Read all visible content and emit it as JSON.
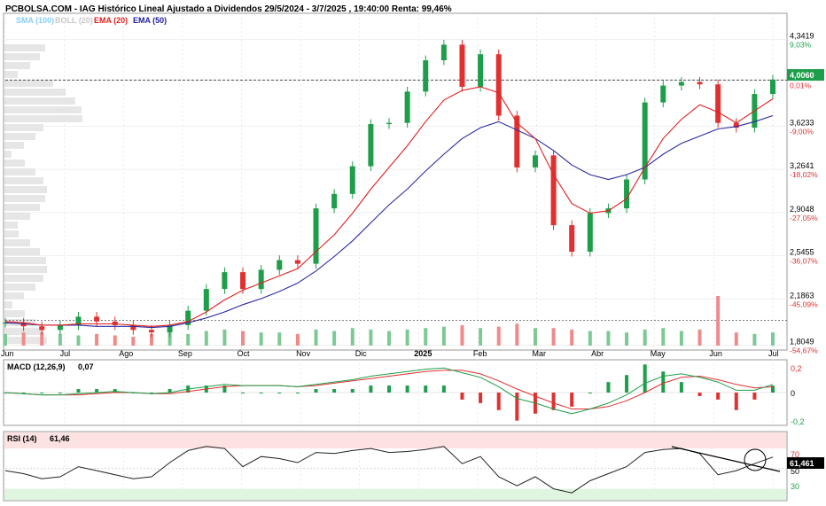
{
  "header": {
    "title": "PCBOLSA.COM - IAG Histórico Lineal Ajustado a Dividendos 29/5/2024 - 3/7/2025 , 19:40:00 Renta: 99,46%"
  },
  "legend": [
    {
      "label": "SMA (100)",
      "color": "#87cefa"
    },
    {
      "label": "BOLL (20)",
      "color": "#cccccc"
    },
    {
      "label": "EMA (20)",
      "color": "#e02020"
    },
    {
      "label": "EMA (50)",
      "color": "#2020a0"
    }
  ],
  "colors": {
    "up": "#1e9e4a",
    "down": "#e03030",
    "ema20": "#e02020",
    "ema50": "#2a2aa0",
    "current_price_tag": "#1e9e4a",
    "rsi_tag": "#000000"
  },
  "x_labels": [
    "Jun",
    "Jul",
    "Ago",
    "Sep",
    "Oct",
    "Nov",
    "Dic",
    "2025",
    "Feb",
    "Mar",
    "Abr",
    "May",
    "Jun",
    "Jul"
  ],
  "price_axis": [
    {
      "value": "4,3419",
      "pct": "9,03%"
    },
    {
      "value": "4,0060",
      "pct": "0,01%"
    },
    {
      "value": "3,6233",
      "pct": "-9,00%"
    },
    {
      "value": "3,2641",
      "pct": "-18,02%"
    },
    {
      "value": "2,9048",
      "pct": "-27,05%"
    },
    {
      "value": "2,5455",
      "pct": "-36,07%"
    },
    {
      "value": "2,1863",
      "pct": "-45,09%"
    },
    {
      "value": "1,8049",
      "pct": "-54,67%"
    }
  ],
  "current_price": "4,0060",
  "macd": {
    "label": "MACD (12,26,9)",
    "value": "0,07",
    "axis": [
      "0,2",
      "0",
      "-0,2"
    ]
  },
  "rsi": {
    "label": "RSI (14)",
    "value": "61,46",
    "current": "61,461",
    "axis": [
      "70",
      "50",
      "30"
    ]
  },
  "chart_data": {
    "type": "candlestick",
    "title": "PCBOLSA.COM - IAG Histórico Lineal Ajustado a Dividendos 29/5/2024 - 3/7/2025 , 19:40:00 Renta: 99,46%",
    "ylim": [
      1.8,
      4.45
    ],
    "x": [
      "Jun",
      "Jul",
      "Ago",
      "Sep",
      "Oct",
      "Nov",
      "Dic",
      "2025",
      "Feb",
      "Mar",
      "Abr",
      "May",
      "Jun",
      "Jul"
    ],
    "series": [
      {
        "name": "price",
        "values": [
          1.99,
          1.96,
          1.93,
          1.97,
          2.04,
          2.0,
          1.97,
          1.93,
          1.91,
          1.97,
          2.09,
          2.27,
          2.41,
          2.27,
          2.43,
          2.51,
          2.48,
          2.94,
          3.06,
          3.29,
          3.64,
          3.65,
          3.91,
          4.17,
          4.3,
          3.95,
          4.22,
          3.71,
          3.28,
          3.38,
          2.8,
          2.58,
          2.9,
          2.94,
          3.18,
          3.82,
          3.96,
          3.99,
          3.97,
          3.65,
          3.61,
          3.89,
          4.01
        ]
      },
      {
        "name": "EMA (20)",
        "values": [
          2.0,
          1.99,
          1.97,
          1.97,
          1.98,
          1.98,
          1.98,
          1.97,
          1.96,
          1.97,
          2.0,
          2.08,
          2.18,
          2.26,
          2.32,
          2.38,
          2.44,
          2.58,
          2.72,
          2.9,
          3.1,
          3.28,
          3.46,
          3.66,
          3.84,
          3.92,
          3.95,
          3.9,
          3.65,
          3.52,
          3.22,
          2.98,
          2.9,
          2.92,
          3.02,
          3.28,
          3.52,
          3.68,
          3.8,
          3.74,
          3.65,
          3.75,
          3.85
        ]
      },
      {
        "name": "EMA (50)",
        "values": [
          1.99,
          1.98,
          1.97,
          1.97,
          1.97,
          1.96,
          1.96,
          1.96,
          1.95,
          1.96,
          1.99,
          2.03,
          2.08,
          2.14,
          2.19,
          2.25,
          2.32,
          2.42,
          2.54,
          2.67,
          2.82,
          2.97,
          3.1,
          3.25,
          3.39,
          3.52,
          3.61,
          3.66,
          3.59,
          3.52,
          3.42,
          3.3,
          3.22,
          3.18,
          3.22,
          3.28,
          3.39,
          3.48,
          3.54,
          3.6,
          3.62,
          3.66,
          3.71
        ]
      }
    ],
    "volume": [
      8,
      9,
      9,
      8,
      7,
      8,
      7,
      6,
      8,
      9,
      8,
      10,
      11,
      10,
      9,
      9,
      8,
      11,
      10,
      12,
      11,
      10,
      11,
      12,
      13,
      14,
      12,
      13,
      15,
      12,
      12,
      11,
      10,
      10,
      9,
      11,
      12,
      10,
      11,
      34,
      9,
      8,
      9
    ],
    "macd": {
      "ylim": [
        -0.25,
        0.25
      ],
      "macd": [
        0.0,
        -0.01,
        -0.02,
        -0.02,
        -0.01,
        0.0,
        0.01,
        0.0,
        -0.01,
        0.0,
        0.03,
        0.05,
        0.07,
        0.06,
        0.06,
        0.06,
        0.05,
        0.07,
        0.09,
        0.11,
        0.14,
        0.16,
        0.18,
        0.2,
        0.21,
        0.17,
        0.13,
        0.05,
        -0.05,
        -0.09,
        -0.14,
        -0.18,
        -0.14,
        -0.09,
        -0.02,
        0.08,
        0.14,
        0.16,
        0.13,
        0.09,
        0.02,
        0.02,
        0.07
      ],
      "signal": [
        0.0,
        -0.01,
        -0.02,
        -0.02,
        -0.02,
        -0.01,
        0.0,
        0.0,
        -0.01,
        -0.01,
        0.01,
        0.03,
        0.05,
        0.06,
        0.06,
        0.06,
        0.05,
        0.06,
        0.08,
        0.1,
        0.12,
        0.14,
        0.16,
        0.18,
        0.19,
        0.19,
        0.16,
        0.1,
        0.03,
        -0.03,
        -0.09,
        -0.14,
        -0.14,
        -0.12,
        -0.07,
        0.0,
        0.08,
        0.13,
        0.14,
        0.11,
        0.07,
        0.04,
        0.05
      ]
    },
    "rsi_series": {
      "ylim": [
        20,
        85
      ],
      "values": [
        48,
        45,
        40,
        42,
        52,
        48,
        44,
        40,
        42,
        56,
        68,
        72,
        70,
        52,
        62,
        60,
        56,
        66,
        65,
        68,
        70,
        66,
        67,
        69,
        72,
        55,
        62,
        42,
        33,
        42,
        30,
        26,
        38,
        45,
        52,
        66,
        69,
        70,
        65,
        44,
        48,
        55,
        61.46
      ]
    }
  }
}
